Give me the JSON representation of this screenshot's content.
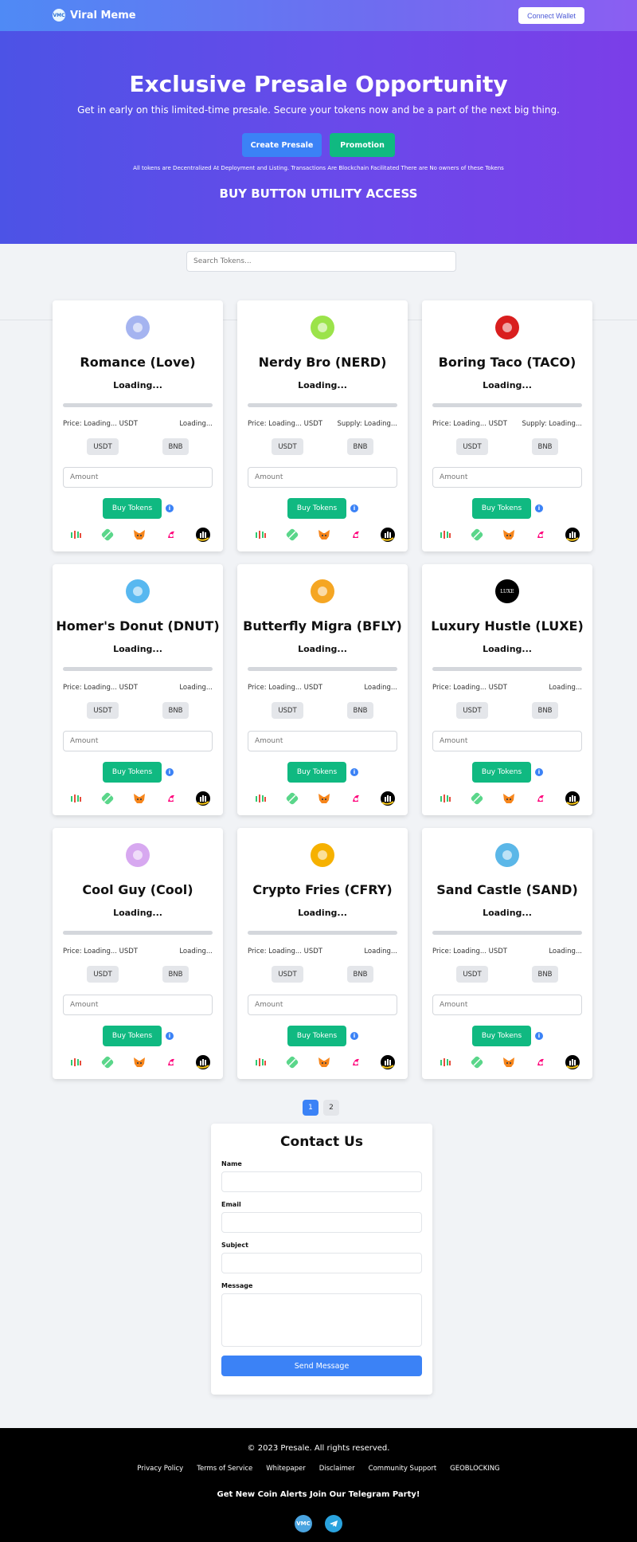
{
  "header": {
    "logo_text": "VMC",
    "brand_name": "Viral Meme",
    "connect_label": "Connect Wallet"
  },
  "hero": {
    "title": "Exclusive Presale Opportunity",
    "subtitle": "Get in early on this limited-time presale. Secure your tokens now and be a part of the next big thing.",
    "create_label": "Create Presale",
    "promo_label": "Promotion",
    "note": "All tokens are Decentralized At Deployment and Listing. Transactions Are Blockchain Facilitated There are No owners of these Tokens",
    "utility": "BUY BUTTON UTILITY ACCESS"
  },
  "search": {
    "placeholder": "Search Tokens..."
  },
  "tokens": [
    {
      "name": "Romance (Love)",
      "loading": "Loading...",
      "price": "Price: Loading... USDT",
      "supply": "Loading...",
      "usdt": "USDT",
      "bnb": "BNB",
      "amount_placeholder": "Amount",
      "buy_label": "Buy Tokens",
      "icon": "romance-token-icon",
      "icon_bg": "#a5b4f0"
    },
    {
      "name": "Nerdy Bro (NERD)",
      "loading": "Loading...",
      "price": "Price: Loading... USDT",
      "supply": "Supply: Loading...",
      "usdt": "USDT",
      "bnb": "BNB",
      "amount_placeholder": "Amount",
      "buy_label": "Buy Tokens",
      "icon": "nerd-token-icon",
      "icon_bg": "#9be34a"
    },
    {
      "name": "Boring Taco (TACO)",
      "loading": "Loading...",
      "price": "Price: Loading... USDT",
      "supply": "Supply: Loading...",
      "usdt": "USDT",
      "bnb": "BNB",
      "amount_placeholder": "Amount",
      "buy_label": "Buy Tokens",
      "icon": "taco-token-icon",
      "icon_bg": "#d91e1e"
    },
    {
      "name": "Homer's Donut (DNUT)",
      "loading": "Loading...",
      "price": "Price: Loading... USDT",
      "supply": "Loading...",
      "usdt": "USDT",
      "bnb": "BNB",
      "amount_placeholder": "Amount",
      "buy_label": "Buy Tokens",
      "icon": "donut-token-icon",
      "icon_bg": "#58b8f0"
    },
    {
      "name": "Butterfly Migra (BFLY)",
      "loading": "Loading...",
      "price": "Price: Loading... USDT",
      "supply": "Loading...",
      "usdt": "USDT",
      "bnb": "BNB",
      "amount_placeholder": "Amount",
      "buy_label": "Buy Tokens",
      "icon": "butterfly-token-icon",
      "icon_bg": "#f5a623"
    },
    {
      "name": "Luxury Hustle (LUXE)",
      "loading": "Loading...",
      "price": "Price: Loading... USDT",
      "supply": "Loading...",
      "usdt": "USDT",
      "bnb": "BNB",
      "amount_placeholder": "Amount",
      "buy_label": "Buy Tokens",
      "icon": "luxe-token-icon",
      "icon_bg": "#000000",
      "icon_text": "LUXE"
    },
    {
      "name": "Cool Guy (Cool)",
      "loading": "Loading...",
      "price": "Price: Loading... USDT",
      "supply": "Loading...",
      "usdt": "USDT",
      "bnb": "BNB",
      "amount_placeholder": "Amount",
      "buy_label": "Buy Tokens",
      "icon": "coolguy-token-icon",
      "icon_bg": "#d7a8f0"
    },
    {
      "name": "Crypto Fries (CFRY)",
      "loading": "Loading...",
      "price": "Price: Loading... USDT",
      "supply": "Loading...",
      "usdt": "USDT",
      "bnb": "BNB",
      "amount_placeholder": "Amount",
      "buy_label": "Buy Tokens",
      "icon": "fries-token-icon",
      "icon_bg": "#f6b100"
    },
    {
      "name": "Sand Castle (SAND)",
      "loading": "Loading...",
      "price": "Price: Loading... USDT",
      "supply": "Loading...",
      "usdt": "USDT",
      "bnb": "BNB",
      "amount_placeholder": "Amount",
      "buy_label": "Buy Tokens",
      "icon": "sandcastle-token-icon",
      "icon_bg": "#5bb7e8"
    }
  ],
  "exchange_icons": [
    "dextools-icon",
    "dexscreener-icon",
    "metamask-icon",
    "uniswap-icon",
    "coinmarketcap-icon"
  ],
  "pagination": {
    "page1": "1",
    "page2": "2"
  },
  "contact": {
    "title": "Contact Us",
    "name_label": "Name",
    "email_label": "Email",
    "subject_label": "Subject",
    "message_label": "Message",
    "send_label": "Send Message"
  },
  "footer": {
    "copyright": "© 2023 Presale. All rights reserved.",
    "links": [
      "Privacy Policy",
      "Terms of Service",
      "Whitepaper",
      "Disclaimer",
      "Community Support",
      "GEOBLOCKING"
    ],
    "telegram_text": "Get New Coin Alerts Join Our Telegram Party!",
    "vmc_icon_text": "VMC"
  },
  "colors": {
    "primary_blue": "#3b82f6",
    "green": "#10b981",
    "hero_gradient_start": "#4c53e6",
    "hero_gradient_end": "#7b3ee8"
  }
}
